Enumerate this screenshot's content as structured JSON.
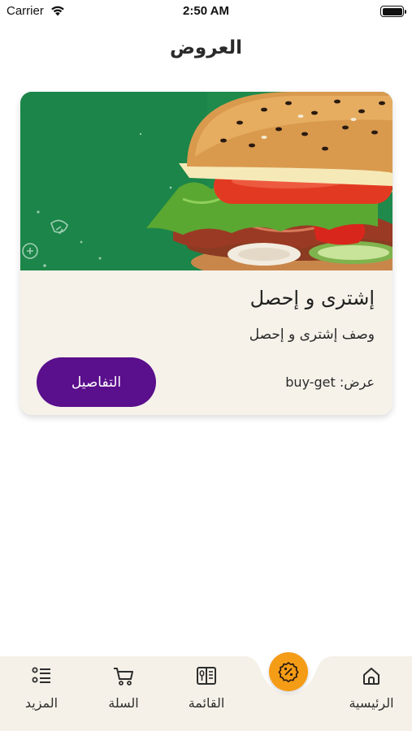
{
  "status_bar": {
    "carrier": "Carrier",
    "time": "2:50 AM"
  },
  "header": {
    "title": "العروض"
  },
  "offer": {
    "title": "إشترى و إحصل",
    "description": "وصف إشترى و إحصل",
    "type_text": "عرض: buy-get",
    "details_label": "التفاصيل",
    "image_subject": "burger"
  },
  "bottom_nav": {
    "items": [
      {
        "label": "الرئيسية",
        "icon": "home-icon"
      },
      {
        "label": "القائمة",
        "icon": "menu-book-icon"
      },
      {
        "label": "السلة",
        "icon": "cart-icon"
      },
      {
        "label": "المزيد",
        "icon": "more-list-icon"
      }
    ],
    "center_icon": "discount-badge-icon"
  },
  "colors": {
    "accent_purple": "#5a0f8c",
    "accent_orange": "#f59c16",
    "card_bg": "#f6f2ea",
    "nav_bg": "#f5f1e8",
    "image_bg_green": "#1f8a4c"
  }
}
